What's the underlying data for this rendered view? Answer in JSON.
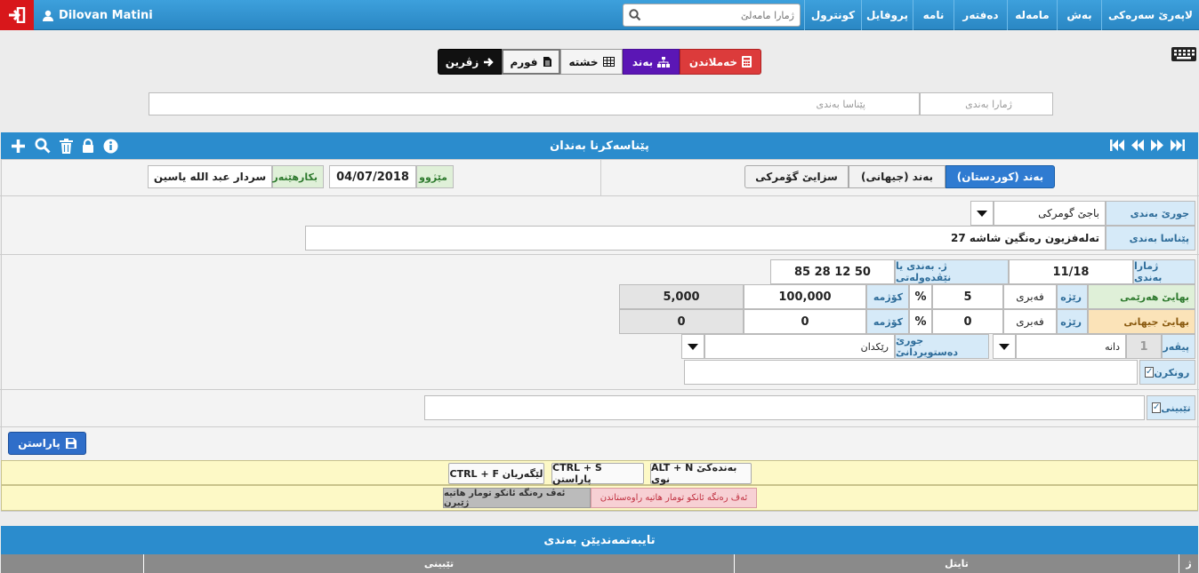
{
  "topbar": {
    "user_name": "Dilovan Matini",
    "search_placeholder": "ژمارا مامەلێ",
    "nav": [
      "لاپەرێ سەرەکی",
      "بەش",
      "مامەلە",
      "دەفتەر",
      "نامە",
      "پروفایل",
      "کونترول"
    ]
  },
  "tabs": {
    "calc": "خەملاندن",
    "band": "بەند",
    "table": "خشتە",
    "form": "فورم",
    "back": "زڤرین"
  },
  "filter": {
    "number_placeholder": "ژمارا بەندی",
    "def_placeholder": "پێناسا بەندی"
  },
  "panel": {
    "title": "پێناسەکرنا بەندان"
  },
  "sub_tabs": [
    "بەند (کوردستان)",
    "بەند (جیهانی)",
    "سزایێ گۆمرکی"
  ],
  "meta": {
    "date_label": "مێژوو",
    "date_value": "04/07/2018",
    "user_label": "بکارهێنەر",
    "user_value": "سردار عبد الله یاسین"
  },
  "form": {
    "type_label": "جورێ بەندی",
    "type_value": "باجێ گومرکی",
    "def_label": "پێناسا بەندی",
    "def_value": "تەلەفزیون رەنگین شاشە 27",
    "num_label": "ژمارا بەندی",
    "num_value": "11/18",
    "intl_label": "ژ. بەندی یا نێڤدەولەتی",
    "intl_value": "85 28 12 50",
    "regional_label": "بهایێ هەرێمی",
    "global_label": "بهایێ جیهانی",
    "rate_label": "رێژە",
    "fabri_label": "فەبری",
    "percent": "%",
    "total_label": "کۆژمە",
    "regional_rate": "5",
    "regional_value": "100,000",
    "regional_total": "5,000",
    "global_rate": "0",
    "global_value": "0",
    "global_total": "0",
    "unit_label": "پیڤەر",
    "unit_qty": "1",
    "unit_value": "دانە",
    "instr_label": "جورێ دەستویردانێ",
    "instr_value": "رێکدان",
    "explain_label": "رونکرن",
    "note_label": "تێبینی",
    "save_label": "پاراستن"
  },
  "shortcuts": [
    "ALT + N بەندەکێ نوی",
    "CTRL + S پاراستن",
    "CTRL + F لێگەریان"
  ],
  "legend": [
    "ئەڤ رەنگە ئانکو تومار هاتیە راوەستاندن",
    "ئەڤ رەنگە ئانکو تومار هاتیە ژێبرن"
  ],
  "bottom": {
    "title": "تایبەتمەندیێن بەندی",
    "col_no": "ژ",
    "col_title": "تایتل",
    "col_note": "تێبینی"
  },
  "colors": {
    "primary": "#2b8ccd",
    "danger": "#d8171b",
    "purple": "#5b16b5",
    "calc_red": "#dc3b3b",
    "shortcut_bg": "#fdf9c6"
  }
}
